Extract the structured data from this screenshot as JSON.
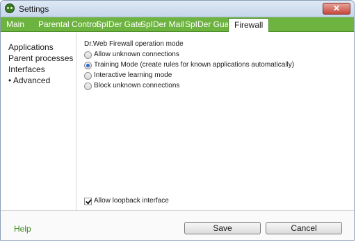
{
  "window": {
    "title": "Settings",
    "close_glyph": "✕"
  },
  "tabs": [
    {
      "label": "Main"
    },
    {
      "label": "Parental Control"
    },
    {
      "label": "SpIDer Gate"
    },
    {
      "label": "SpIDer Mail"
    },
    {
      "label": "SpIDer Guard"
    },
    {
      "label": "Firewall",
      "active": true
    }
  ],
  "sidebar": {
    "items": [
      {
        "label": "Applications"
      },
      {
        "label": "Parent processes"
      },
      {
        "label": "Interfaces"
      },
      {
        "label": "• Advanced",
        "active": true
      }
    ]
  },
  "firewall": {
    "section_label": "Dr.Web Firewall operation mode",
    "modes": [
      {
        "label": "Allow unknown connections",
        "selected": false
      },
      {
        "label": "Training Mode (create rules for known applications automatically)",
        "selected": true
      },
      {
        "label": "Interactive learning mode",
        "selected": false
      },
      {
        "label": "Block unknown connections",
        "selected": false
      }
    ],
    "loopback": {
      "label": "Allow loopback interface",
      "checked": true
    }
  },
  "footer": {
    "help": "Help",
    "save": "Save",
    "cancel": "Cancel"
  },
  "colors": {
    "tab_bar": "#6db33f",
    "help_link": "#3a8a1a",
    "radio_selected": "#2a6bd0"
  }
}
